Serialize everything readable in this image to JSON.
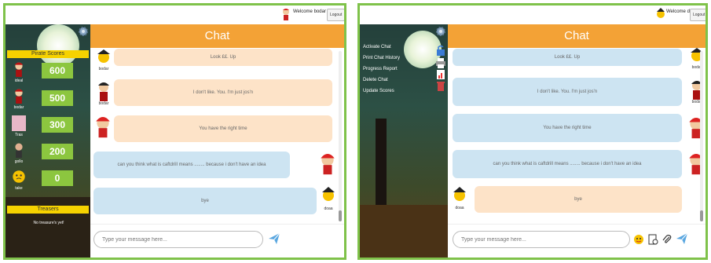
{
  "left_panel": {
    "welcome": "Welcome bodar",
    "logout": "Logout",
    "chat_title": "Chat",
    "scores_title": "Pirate Scores",
    "scores": [
      {
        "name": "ideal",
        "score": "600"
      },
      {
        "name": "bodar",
        "score": "500"
      },
      {
        "name": "Tras",
        "score": "300"
      },
      {
        "name": "gollo",
        "score": "200"
      },
      {
        "name": "take",
        "score": "0"
      }
    ],
    "treasures_title": "Treasers",
    "treasures_empty": "No treasure's yet!",
    "messages": [
      {
        "text": "Look ££. Up",
        "sender": "bodar"
      },
      {
        "text": "I don't like. You. I'm just jos'n",
        "sender": "bodar"
      },
      {
        "text": "You have the right time",
        "sender": ""
      },
      {
        "text": "can you think what is caftdrill means ........ because i don't have an idea",
        "sender": ""
      },
      {
        "text": "bye",
        "sender": "doaa"
      }
    ],
    "input_placeholder": "Type your message here..."
  },
  "right_panel": {
    "welcome": "Welcome doaa",
    "logout": "Logout",
    "chat_title": "Chat",
    "menu": [
      "Activate Chat",
      "Print Chat History",
      "Progress Report",
      "Delete Chat",
      "Update Scores"
    ],
    "messages": [
      {
        "text": "Look ££. Up",
        "sender": "bodar"
      },
      {
        "text": "I don't like. You. I'm just jos'n",
        "sender": "bodar"
      },
      {
        "text": "You have the right time",
        "sender": ""
      },
      {
        "text": "can you think what is caftdrill means ........ because i don't have an idea",
        "sender": ""
      },
      {
        "text": "bye",
        "sender": "doaa"
      }
    ],
    "input_placeholder": "Type your message here..."
  },
  "colors": {
    "accent_orange": "#f3a236",
    "score_green": "#8cc63f",
    "frame_green": "#7fc24a",
    "bubble_peach": "#fde3c8",
    "bubble_blue": "#cde4f2"
  }
}
